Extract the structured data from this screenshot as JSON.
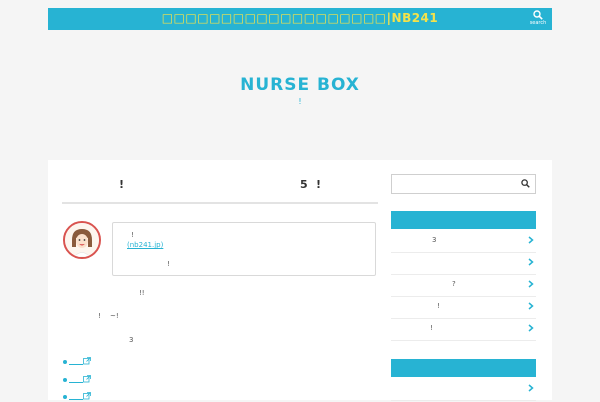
{
  "header": {
    "site_label": "□□□□□□□□□□□□□□□□□□□|NB241",
    "search_label": "search",
    "bar_color": "#27b3d3",
    "label_color": "#f3e24a"
  },
  "site": {
    "title": "NURSE BOX",
    "tagline": "!"
  },
  "article": {
    "title_marks": [
      "!",
      "5",
      "!"
    ],
    "profile": {
      "line1": "!",
      "link": "(nb241.jp)",
      "line3": "!"
    },
    "paragraphs": [
      "!!",
      "!",
      "~!",
      "3"
    ]
  },
  "sidebar": {
    "search_placeholder": "",
    "items": [
      {
        "text": "3"
      },
      {
        "text": ""
      },
      {
        "text": "?"
      },
      {
        "text": "!"
      },
      {
        "text": "!"
      }
    ]
  }
}
